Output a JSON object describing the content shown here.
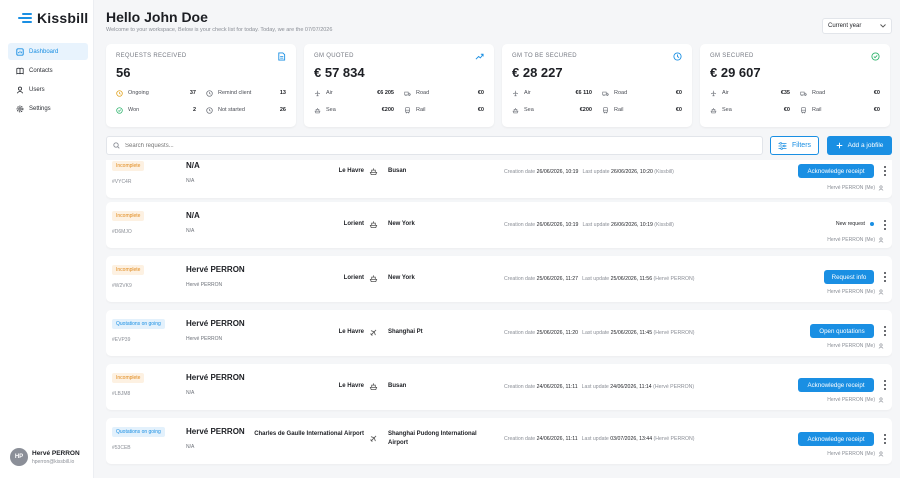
{
  "app": {
    "name": "Kissbill"
  },
  "sidebar": {
    "items": [
      {
        "label": "Dashboard",
        "icon": "dashboard-icon",
        "active": true
      },
      {
        "label": "Contacts",
        "icon": "book-icon",
        "active": false
      },
      {
        "label": "Users",
        "icon": "user-icon",
        "active": false
      },
      {
        "label": "Settings",
        "icon": "gear-icon",
        "active": false
      }
    ],
    "user": {
      "initials": "HP",
      "name": "Hervé PERRON",
      "email": "hperron@kissbill.io"
    }
  },
  "header": {
    "greeting": "Hello John Doe",
    "subtitle": "Welcome to your workspace, Below is your check list for today. Today, we are the 07/07/2026",
    "period": "Current year"
  },
  "accent_color": "#1a8fe3",
  "cards": [
    {
      "title": "REQUESTS RECEIVED",
      "icon": "document-icon",
      "icon_color": "#1a8fe3",
      "value": "56",
      "stats": [
        {
          "label": "Ongoing",
          "value": "37",
          "icon": "clock-icon",
          "color": "#e0a11b"
        },
        {
          "label": "Remind client",
          "value": "13",
          "icon": "clock-icon",
          "color": "#6d7179"
        },
        {
          "label": "Won",
          "value": "2",
          "icon": "check-circle-icon",
          "color": "#2db36c"
        },
        {
          "label": "Not started",
          "value": "26",
          "icon": "clock-icon",
          "color": "#6d7179"
        }
      ]
    },
    {
      "title": "GM QUOTED",
      "icon": "trend-up-icon",
      "icon_color": "#1a8fe3",
      "value": "€ 57 834",
      "stats": [
        {
          "label": "Air",
          "value": "€6 205",
          "icon": "plane-icon"
        },
        {
          "label": "Road",
          "value": "€0",
          "icon": "truck-icon"
        },
        {
          "label": "Sea",
          "value": "€200",
          "icon": "ship-icon"
        },
        {
          "label": "Rail",
          "value": "€0",
          "icon": "train-icon"
        }
      ]
    },
    {
      "title": "GM TO BE SECURED",
      "icon": "timer-icon",
      "icon_color": "#1a8fe3",
      "value": "€ 28 227",
      "stats": [
        {
          "label": "Air",
          "value": "€6 110",
          "icon": "plane-icon"
        },
        {
          "label": "Road",
          "value": "€0",
          "icon": "truck-icon"
        },
        {
          "label": "Sea",
          "value": "€200",
          "icon": "ship-icon"
        },
        {
          "label": "Rail",
          "value": "€0",
          "icon": "train-icon"
        }
      ]
    },
    {
      "title": "GM SECURED",
      "icon": "check-circle-icon",
      "icon_color": "#2db36c",
      "value": "€ 29 607",
      "stats": [
        {
          "label": "Air",
          "value": "€35",
          "icon": "plane-icon"
        },
        {
          "label": "Road",
          "value": "€0",
          "icon": "truck-icon"
        },
        {
          "label": "Sea",
          "value": "€0",
          "icon": "ship-icon"
        },
        {
          "label": "Rail",
          "value": "€0",
          "icon": "train-icon"
        }
      ]
    }
  ],
  "toolbar": {
    "search_placeholder": "Search requests...",
    "filters_label": "Filters",
    "add_label": "Add a jobfile"
  },
  "requests": [
    {
      "status": "Incomplete",
      "status_type": "incomplete",
      "ref": "#VYC4R",
      "customer": "N/A",
      "contact": "N/A",
      "origin": "Le Havre",
      "mode": "ship-icon",
      "destination": "Busan",
      "creation_label": "Creation date",
      "creation": "26/06/2026, 10:19",
      "update_label": "Last update",
      "update": "26/06/2026, 10:20",
      "update_by": "(Kissbill)",
      "action": "Acknowledge receipt",
      "assignee": "Hervé PERRON (Me)"
    },
    {
      "status": "Incomplete",
      "status_type": "incomplete",
      "ref": "#D6MJO",
      "customer": "N/A",
      "contact": "N/A",
      "origin": "Lorient",
      "mode": "ship-icon",
      "destination": "New York",
      "creation_label": "Creation date",
      "creation": "26/06/2026, 10:19",
      "update_label": "Last update",
      "update": "26/06/2026, 10:19",
      "update_by": "(Kissbill)",
      "action": "",
      "status_text": "New request",
      "assignee": "Hervé PERRON (Me)"
    },
    {
      "status": "Incomplete",
      "status_type": "incomplete",
      "ref": "#W2VK9",
      "customer": "Hervé PERRON",
      "contact": "Hervé PERRON",
      "origin": "Lorient",
      "mode": "ship-icon",
      "destination": "New York",
      "creation_label": "Creation date",
      "creation": "25/06/2026, 11:27",
      "update_label": "Last update",
      "update": "25/06/2026, 11:56",
      "update_by": "(Hervé PERRON)",
      "action": "Request info",
      "assignee": "Hervé PERRON (Me)"
    },
    {
      "status": "Quotations on going",
      "status_type": "quotation",
      "ref": "#EVP39",
      "customer": "Hervé PERRON",
      "contact": "Hervé PERRON",
      "origin": "Le Havre",
      "mode": "plane-icon",
      "destination": "Shanghai Pt",
      "creation_label": "Creation date",
      "creation": "25/06/2026, 11:20",
      "update_label": "Last update",
      "update": "25/06/2026, 11:45",
      "update_by": "(Hervé PERRON)",
      "action": "Open quotations",
      "assignee": "Hervé PERRON (Me)"
    },
    {
      "status": "Incomplete",
      "status_type": "incomplete",
      "ref": "#LBJM8",
      "customer": "Hervé PERRON",
      "contact": "N/A",
      "origin": "Le Havre",
      "mode": "ship-icon",
      "destination": "Busan",
      "creation_label": "Creation date",
      "creation": "24/06/2026, 11:11",
      "update_label": "Last update",
      "update": "24/06/2026, 11:14",
      "update_by": "(Hervé PERRON)",
      "action": "Acknowledge receipt",
      "assignee": "Hervé PERRON (Me)"
    },
    {
      "status": "Quotations on going",
      "status_type": "quotation",
      "ref": "#53CEB",
      "customer": "Hervé PERRON",
      "contact": "N/A",
      "origin": "Charles de Gaulle International Airport",
      "mode": "plane-icon",
      "destination": "Shanghai Pudong International Airport",
      "creation_label": "Creation date",
      "creation": "24/06/2026, 11:11",
      "update_label": "Last update",
      "update": "03/07/2026, 13:44",
      "update_by": "(Hervé PERRON)",
      "action": "Acknowledge receipt",
      "assignee": "Hervé PERRON (Me)"
    }
  ]
}
